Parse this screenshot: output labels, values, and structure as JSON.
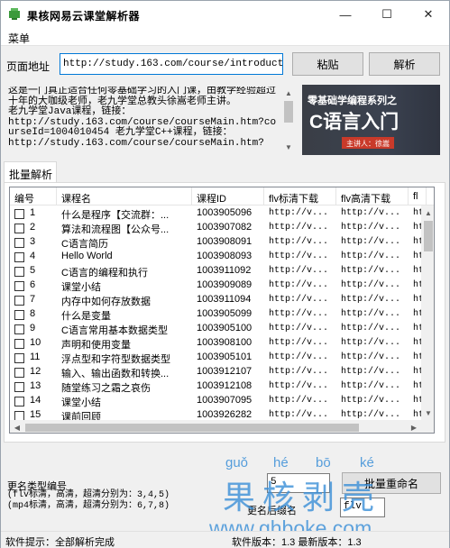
{
  "window": {
    "title": "果核网易云课堂解析器",
    "minimize_glyph": "—",
    "maximize_glyph": "☐",
    "close_glyph": "✕",
    "icon": "green-app-icon"
  },
  "menu": {
    "label": "菜单"
  },
  "url_bar": {
    "label": "页面地址",
    "value": "http://study.163.com/course/introduction/",
    "paste_label": "粘贴",
    "parse_label": "解析"
  },
  "description": {
    "text": "这是一门真正适合任何零基础学习的入门课，由教学经验超过十年的大咖级老师，老九学堂总教头徐嵩老师主讲。\n老九学堂Java课程，链接：\nhttp://study.163.com/course/courseMain.htm?courseId=1004010454 老九学堂C++课程，链接：\nhttp://study.163.com/course/courseMain.htm?"
  },
  "banner": {
    "subtitle": "零基础学编程系列之",
    "title": "C语言入门",
    "teacher": "主讲人：徐嵩"
  },
  "tab": {
    "label": "批量解析"
  },
  "table": {
    "columns": [
      "编号",
      "课程名",
      "课程ID",
      "flv标清下载",
      "flv高清下载",
      "fl"
    ],
    "rows": [
      {
        "num": "1",
        "name": "什么是程序【交流群：...",
        "id": "1003905096",
        "flv_sd": "http://v...",
        "flv_hd": "http://v...",
        "extra": "ht"
      },
      {
        "num": "2",
        "name": "算法和流程图【公众号...",
        "id": "1003907082",
        "flv_sd": "http://v...",
        "flv_hd": "http://v...",
        "extra": "ht"
      },
      {
        "num": "3",
        "name": "C语言简历",
        "id": "1003908091",
        "flv_sd": "http://v...",
        "flv_hd": "http://v...",
        "extra": "ht"
      },
      {
        "num": "4",
        "name": "Hello World",
        "id": "1003908093",
        "flv_sd": "http://v...",
        "flv_hd": "http://v...",
        "extra": "ht"
      },
      {
        "num": "5",
        "name": "C语言的编程和执行",
        "id": "1003911092",
        "flv_sd": "http://v...",
        "flv_hd": "http://v...",
        "extra": "ht"
      },
      {
        "num": "6",
        "name": "课堂小结",
        "id": "1003909089",
        "flv_sd": "http://v...",
        "flv_hd": "http://v...",
        "extra": "ht"
      },
      {
        "num": "7",
        "name": "内存中如何存放数据",
        "id": "1003911094",
        "flv_sd": "http://v...",
        "flv_hd": "http://v...",
        "extra": "ht"
      },
      {
        "num": "8",
        "name": "什么是变量",
        "id": "1003905099",
        "flv_sd": "http://v...",
        "flv_hd": "http://v...",
        "extra": "ht"
      },
      {
        "num": "9",
        "name": "C语言常用基本数据类型",
        "id": "1003905100",
        "flv_sd": "http://v...",
        "flv_hd": "http://v...",
        "extra": "ht"
      },
      {
        "num": "10",
        "name": "声明和使用变量",
        "id": "1003908100",
        "flv_sd": "http://v...",
        "flv_hd": "http://v...",
        "extra": "ht"
      },
      {
        "num": "11",
        "name": "浮点型和字符型数据类型",
        "id": "1003905101",
        "flv_sd": "http://v...",
        "flv_hd": "http://v...",
        "extra": "ht"
      },
      {
        "num": "12",
        "name": "输入、输出函数和转换...",
        "id": "1003912107",
        "flv_sd": "http://v...",
        "flv_hd": "http://v...",
        "extra": "ht"
      },
      {
        "num": "13",
        "name": "随堂练习之霜之哀伤",
        "id": "1003912108",
        "flv_sd": "http://v...",
        "flv_hd": "http://v...",
        "extra": "ht"
      },
      {
        "num": "14",
        "name": "课堂小结",
        "id": "1003907095",
        "flv_sd": "http://v...",
        "flv_hd": "http://v...",
        "extra": "ht"
      },
      {
        "num": "15",
        "name": "课前回顾",
        "id": "1003926282",
        "flv_sd": "http://v...",
        "flv_hd": "http://v...",
        "extra": "ht"
      }
    ]
  },
  "rename": {
    "type_label": "更名类型编号",
    "type_hint": "(flv标清，高清，超清分别为：3,4,5)\n(mp4标清，高清，超清分别为：6,7,8)",
    "type_value": "5",
    "suffix_label": "更名后缀名",
    "suffix_value": "flv",
    "batch_button": "批量重命名"
  },
  "status": {
    "left": "软件提示：全部解析完成",
    "right": "软件版本：1.3 最新版本：1.3"
  },
  "watermark": {
    "pinyin": [
      "guǒ",
      "hé",
      "bō",
      "ké"
    ],
    "text": "果核剥壳",
    "url": "www.ghboke.com"
  }
}
